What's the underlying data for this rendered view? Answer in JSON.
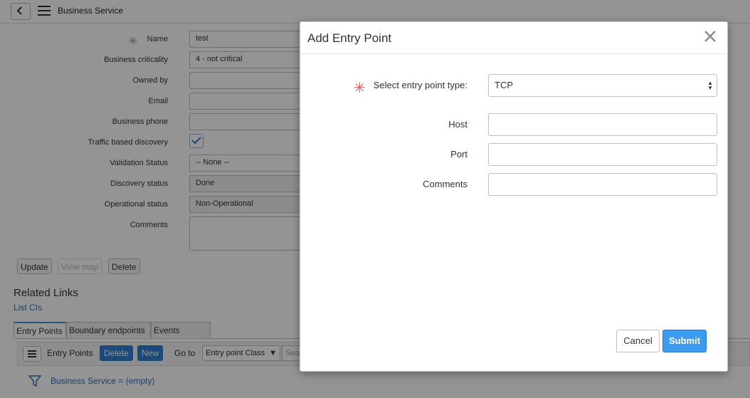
{
  "header": {
    "title": "Business Service"
  },
  "form": {
    "name_label": "Name",
    "name_value": "test",
    "criticality_label": "Business criticality",
    "criticality_value": "4 - not critical",
    "owned_by_label": "Owned by",
    "email_label": "Email",
    "phone_label": "Business phone",
    "traffic_label": "Traffic based discovery",
    "validation_label": "Validation Status",
    "validation_value": "-- None --",
    "discovery_label": "Discovery status",
    "discovery_value": "Done",
    "operational_label": "Operational status",
    "operational_value": "Non-Operational",
    "comments_label": "Comments"
  },
  "actions": {
    "update": "Update",
    "view_map": "View map",
    "delete": "Delete"
  },
  "related": {
    "title": "Related Links",
    "list_cis": "List CIs"
  },
  "tabs": [
    {
      "label": "Entry Points"
    },
    {
      "label": "Boundary endpoints"
    },
    {
      "label": "Events Logged"
    }
  ],
  "list": {
    "title": "Entry Points",
    "delete_btn": "Delete",
    "new_btn": "New",
    "goto_label": "Go to",
    "goto_value": "Entry point Class",
    "search_placeholder": "Sea",
    "filter_text": "Business Service = (empty)"
  },
  "modal": {
    "title": "Add Entry Point",
    "type_label": "Select entry point type:",
    "type_value": "TCP",
    "host_label": "Host",
    "port_label": "Port",
    "comments_label": "Comments",
    "cancel": "Cancel",
    "submit": "Submit"
  },
  "colors": {
    "accent": "#3a9bf0",
    "link": "#2d6fb3",
    "required": "#d9534f"
  }
}
